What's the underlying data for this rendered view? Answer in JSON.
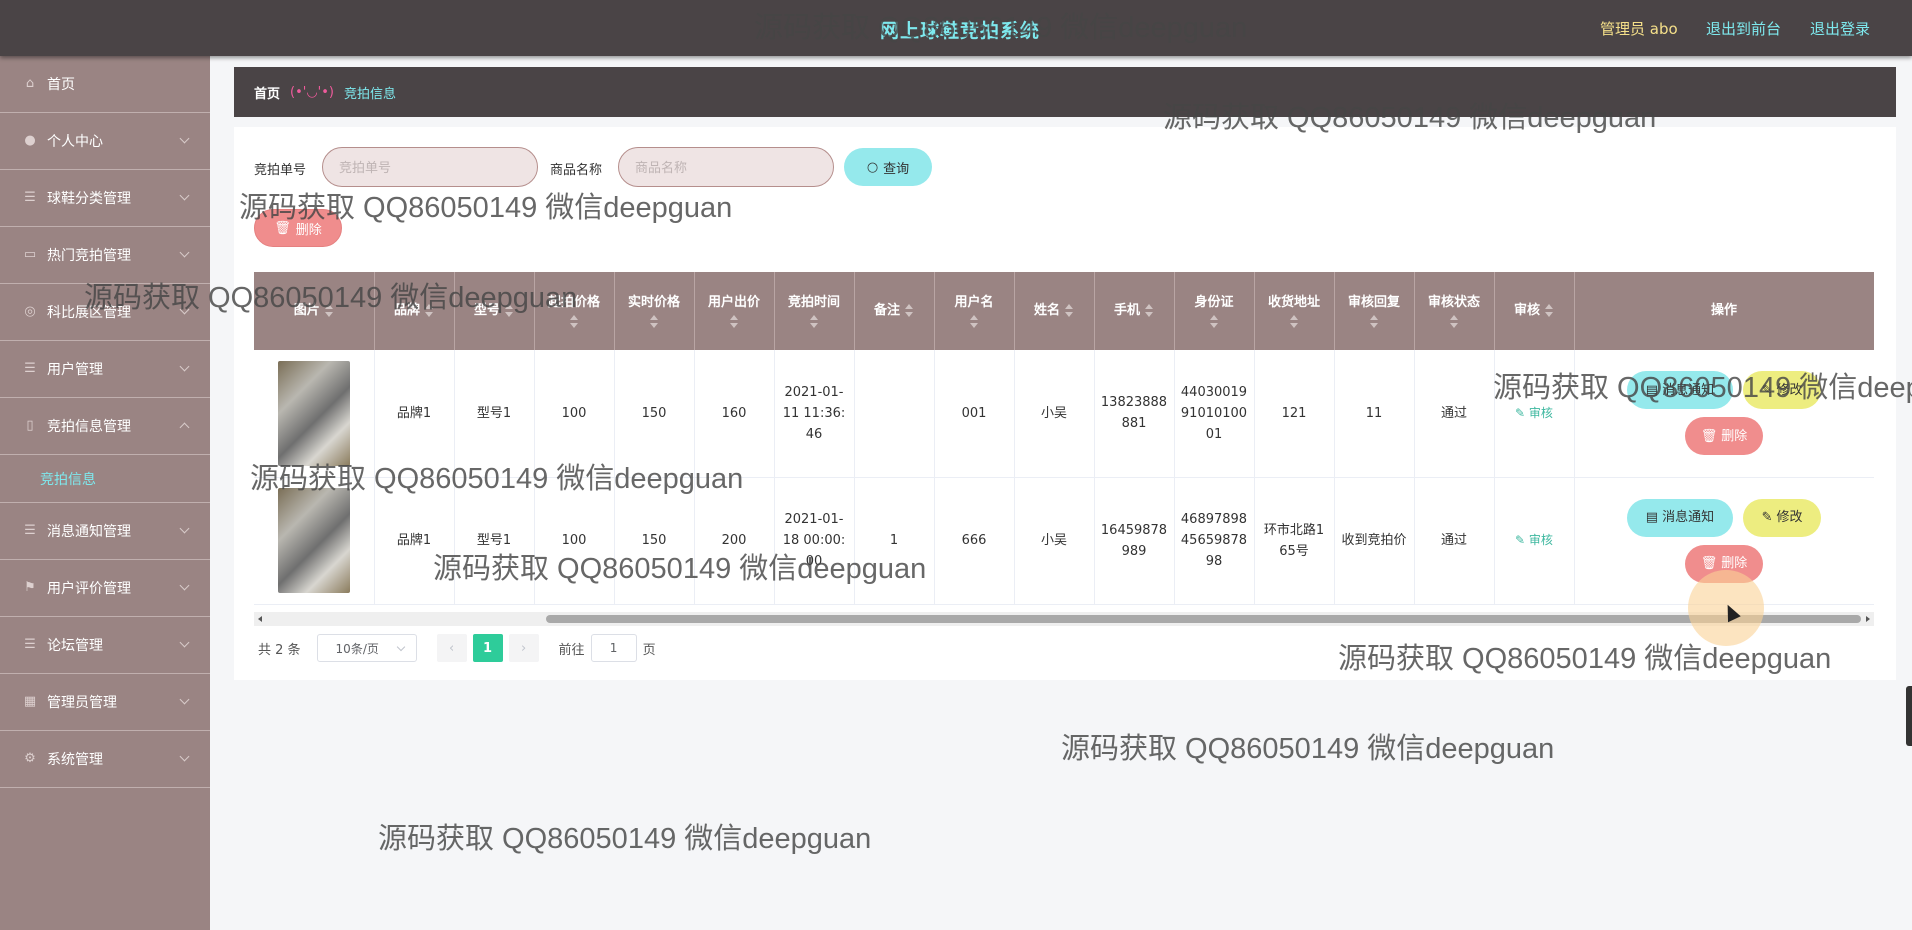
{
  "header": {
    "title": "网上球鞋竞拍系统",
    "admin_label": "管理员 abo",
    "to_front": "退出到前台",
    "logout": "退出登录"
  },
  "sidebar": {
    "items": [
      {
        "label": "首页",
        "icon": "home-icon"
      },
      {
        "label": "个人中心",
        "icon": "user-icon"
      },
      {
        "label": "球鞋分类管理",
        "icon": "menu-icon"
      },
      {
        "label": "热门竞拍管理",
        "icon": "fire-icon"
      },
      {
        "label": "科比展区管理",
        "icon": "star-icon"
      },
      {
        "label": "用户管理",
        "icon": "menu-icon"
      },
      {
        "label": "竞拍信息管理",
        "icon": "document-icon"
      },
      {
        "label": "消息通知管理",
        "icon": "menu-icon"
      },
      {
        "label": "用户评价管理",
        "icon": "flag-icon"
      },
      {
        "label": "论坛管理",
        "icon": "menu-icon"
      },
      {
        "label": "管理员管理",
        "icon": "menu-icon"
      },
      {
        "label": "系统管理",
        "icon": "gear-icon"
      }
    ],
    "active_sub": "竞拍信息"
  },
  "breadcrumb": {
    "home": "首页",
    "face": "(•'◡'•)",
    "current": "竞拍信息"
  },
  "search": {
    "order_label": "竞拍单号",
    "order_placeholder": "竞拍单号",
    "name_label": "商品名称",
    "name_placeholder": "商品名称",
    "query_button": "查询",
    "delete_button": "删除"
  },
  "table": {
    "columns": [
      "图片",
      "品牌",
      "型号",
      "起拍价格",
      "实时价格",
      "用户出价",
      "竞拍时间",
      "备注",
      "用户名",
      "姓名",
      "手机",
      "身份证",
      "收货地址",
      "审核回复",
      "审核状态",
      "审核",
      "操作"
    ],
    "rows": [
      {
        "brand": "品牌1",
        "model": "型号1",
        "start_price": "100",
        "live_price": "150",
        "bid": "160",
        "time": "2021-01-11 11:36:46",
        "remark": "",
        "username": "001",
        "name": "小吴",
        "phone": "13823888881",
        "id_card": "440300199101010001",
        "address": "121",
        "reply": "11",
        "status": "通过",
        "audit": "审核"
      },
      {
        "brand": "品牌1",
        "model": "型号1",
        "start_price": "100",
        "live_price": "150",
        "bid": "200",
        "time": "2021-01-18 00:00:00",
        "remark": "1",
        "username": "666",
        "name": "小吴",
        "phone": "16459878989",
        "id_card": "468978984565987898",
        "address": "环市北路165号",
        "reply": "收到竞拍价",
        "status": "通过",
        "audit": "审核"
      }
    ],
    "actions": {
      "notify": "消息通知",
      "edit": "修改",
      "delete": "删除"
    }
  },
  "pagination": {
    "total": "共 2 条",
    "page_size": "10条/页",
    "current_page": "1",
    "goto_prefix": "前往",
    "goto_value": "1",
    "goto_suffix": "页"
  },
  "watermark": "源码获取 QQ86050149 微信deepguan"
}
